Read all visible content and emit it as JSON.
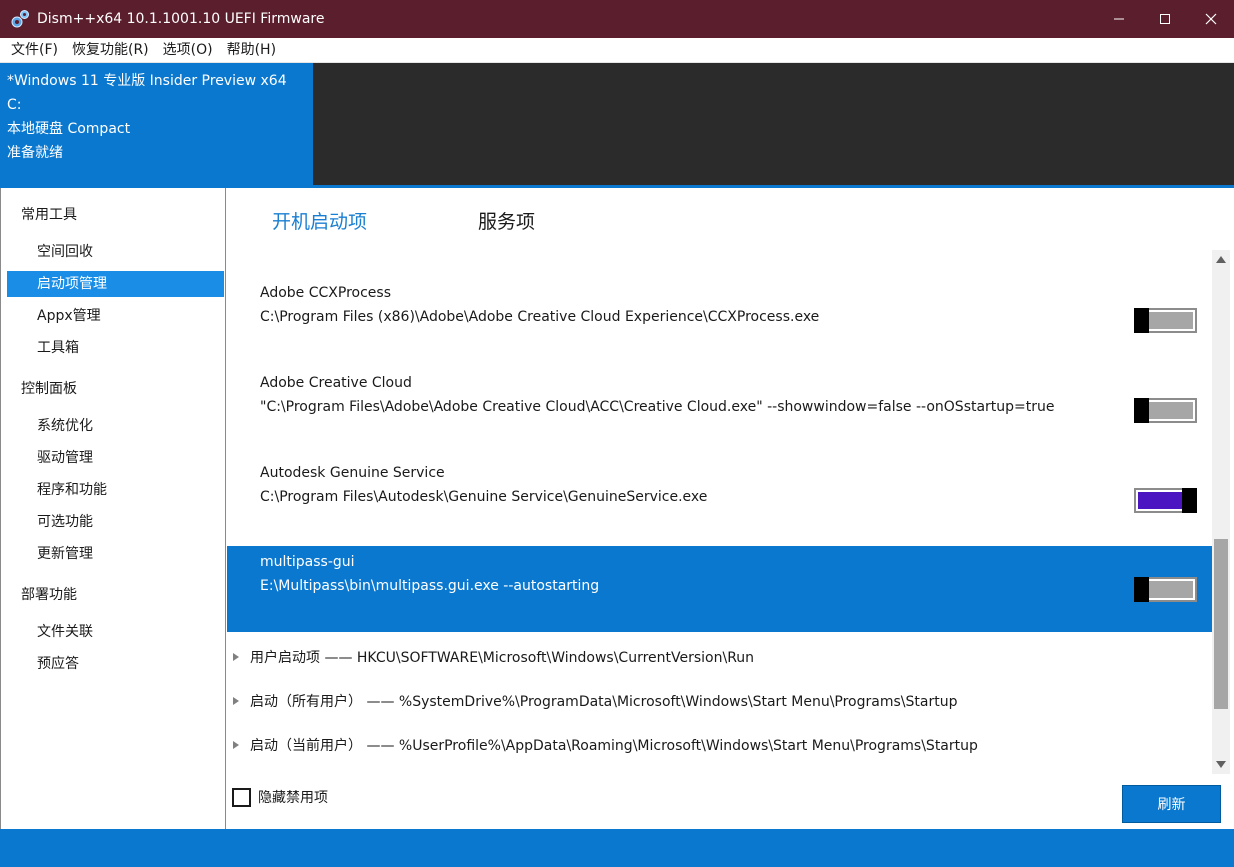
{
  "window": {
    "title": "Dism++x64 10.1.1001.10 UEFI Firmware",
    "title_bg": "#5a1e2d",
    "controls": [
      "minimize-icon",
      "maximize-icon",
      "close-icon"
    ]
  },
  "menu": {
    "items": [
      {
        "label": "文件(F)"
      },
      {
        "label": "恢复功能(R)"
      },
      {
        "label": "选项(O)"
      },
      {
        "label": "帮助(H)"
      }
    ]
  },
  "image_info": {
    "os": "*Windows 11 专业版 Insider Preview x64",
    "drive": "C:",
    "disk": "本地硬盘 Compact",
    "status": "准备就绪"
  },
  "sidebar": {
    "groups": [
      {
        "label": "常用工具",
        "items": [
          {
            "label": "空间回收"
          },
          {
            "label": "启动项管理",
            "active": true
          },
          {
            "label": "Appx管理"
          },
          {
            "label": "工具箱"
          }
        ]
      },
      {
        "label": "控制面板",
        "items": [
          {
            "label": "系统优化"
          },
          {
            "label": "驱动管理"
          },
          {
            "label": "程序和功能"
          },
          {
            "label": "可选功能"
          },
          {
            "label": "更新管理"
          }
        ]
      },
      {
        "label": "部署功能",
        "items": [
          {
            "label": "文件关联"
          },
          {
            "label": "预应答"
          }
        ]
      }
    ]
  },
  "tabs": [
    {
      "label": "开机启动项",
      "active": true
    },
    {
      "label": "服务项",
      "active": false
    }
  ],
  "entries": [
    {
      "name": "Adobe CCXProcess",
      "path": "C:\\Program Files (x86)\\Adobe\\Adobe Creative Cloud Experience\\CCXProcess.exe",
      "enabled": false,
      "selected": false
    },
    {
      "name": "Adobe Creative Cloud",
      "path": "\"C:\\Program Files\\Adobe\\Adobe Creative Cloud\\ACC\\Creative Cloud.exe\" --showwindow=false --onOSstartup=true",
      "enabled": false,
      "selected": false
    },
    {
      "name": "Autodesk Genuine Service",
      "path": "C:\\Program Files\\Autodesk\\Genuine Service\\GenuineService.exe",
      "enabled": true,
      "selected": false
    },
    {
      "name": "multipass-gui",
      "path": "E:\\Multipass\\bin\\multipass.gui.exe --autostarting",
      "enabled": false,
      "selected": true
    }
  ],
  "groups": [
    {
      "label": "用户启动项 —— HKCU\\SOFTWARE\\Microsoft\\Windows\\CurrentVersion\\Run"
    },
    {
      "label": "启动（所有用户） —— %SystemDrive%\\ProgramData\\Microsoft\\Windows\\Start Menu\\Programs\\Startup"
    },
    {
      "label": "启动（当前用户） —— %UserProfile%\\AppData\\Roaming\\Microsoft\\Windows\\Start Menu\\Programs\\Startup"
    }
  ],
  "hide_disabled": {
    "label": "隐藏禁用项",
    "checked": false
  },
  "refresh_button": {
    "label": "刷新"
  },
  "colors": {
    "accent": "#0b78d0",
    "selected_item": "#1a8ee6",
    "toggle_on": "#4b16c2",
    "header_dark": "#2b2b2b"
  }
}
